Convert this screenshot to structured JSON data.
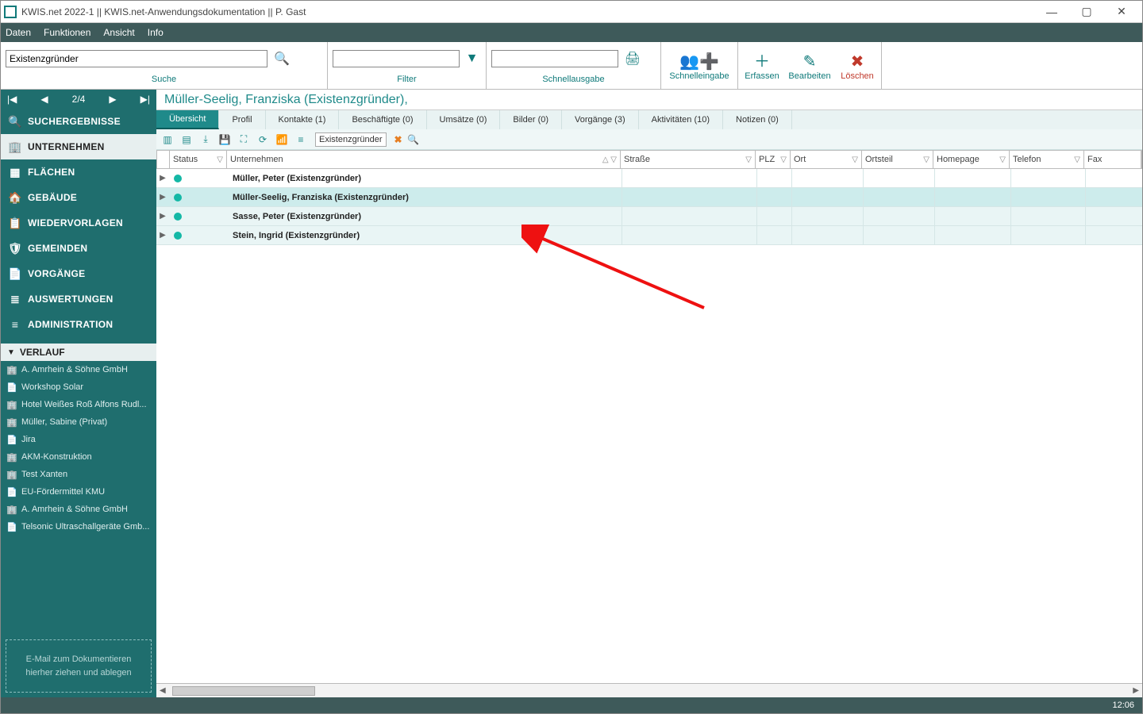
{
  "title": "KWIS.net 2022-1 || KWIS.net-Anwendungsdokumentation || P. Gast",
  "menu": {
    "items": [
      "Daten",
      "Funktionen",
      "Ansicht",
      "Info"
    ]
  },
  "toolbar": {
    "search_value": "Existenzgründer",
    "search_label": "Suche",
    "filter_label": "Filter",
    "schnellausgabe_label": "Schnellausgabe",
    "actions": {
      "schnelleingabe": "Schnelleingabe",
      "erfassen": "Erfassen",
      "bearbeiten": "Bearbeiten",
      "loeschen": "Löschen"
    }
  },
  "pager": {
    "pos": "2/4"
  },
  "sidebar": {
    "items": [
      {
        "label": "SUCHERGEBNISSE"
      },
      {
        "label": "UNTERNEHMEN"
      },
      {
        "label": "FLÄCHEN"
      },
      {
        "label": "GEBÄUDE"
      },
      {
        "label": "WIEDERVORLAGEN"
      },
      {
        "label": "GEMEINDEN"
      },
      {
        "label": "VORGÄNGE"
      },
      {
        "label": "AUSWERTUNGEN"
      },
      {
        "label": "ADMINISTRATION"
      }
    ],
    "verlauf_label": "VERLAUF",
    "verlauf": [
      "A. Amrhein & Söhne GmbH",
      "Workshop Solar",
      "Hotel Weißes Roß Alfons Rudl...",
      "Müller, Sabine (Privat)",
      "Jira",
      "AKM-Konstruktion",
      "Test Xanten",
      "EU-Fördermittel KMU",
      "A. Amrhein & Söhne GmbH",
      "Telsonic Ultraschallgeräte Gmb..."
    ],
    "dropzone": "E-Mail  zum Dokumentieren hierher ziehen und ablegen"
  },
  "main": {
    "crumb": "Müller-Seelig, Franziska (Existenzgründer),",
    "tabs": [
      {
        "label": "Übersicht"
      },
      {
        "label": "Profil"
      },
      {
        "label": "Kontakte (1)"
      },
      {
        "label": "Beschäftigte (0)"
      },
      {
        "label": "Umsätze (0)"
      },
      {
        "label": "Bilder (0)"
      },
      {
        "label": "Vorgänge (3)"
      },
      {
        "label": "Aktivitäten (10)"
      },
      {
        "label": "Notizen (0)"
      }
    ],
    "filter_chip": "Existenzgründer",
    "columns": {
      "status": "Status",
      "unternehmen": "Unternehmen",
      "strasse": "Straße",
      "plz": "PLZ",
      "ort": "Ort",
      "ortsteil": "Ortsteil",
      "homepage": "Homepage",
      "telefon": "Telefon",
      "fax": "Fax"
    },
    "rows": [
      {
        "name": "Müller, Peter (Existenzgründer)"
      },
      {
        "name": "Müller-Seelig, Franziska (Existenzgründer)"
      },
      {
        "name": "Sasse, Peter (Existenzgründer)"
      },
      {
        "name": "Stein, Ingrid (Existenzgründer)"
      }
    ]
  },
  "statusbar": {
    "time": "12:06"
  }
}
